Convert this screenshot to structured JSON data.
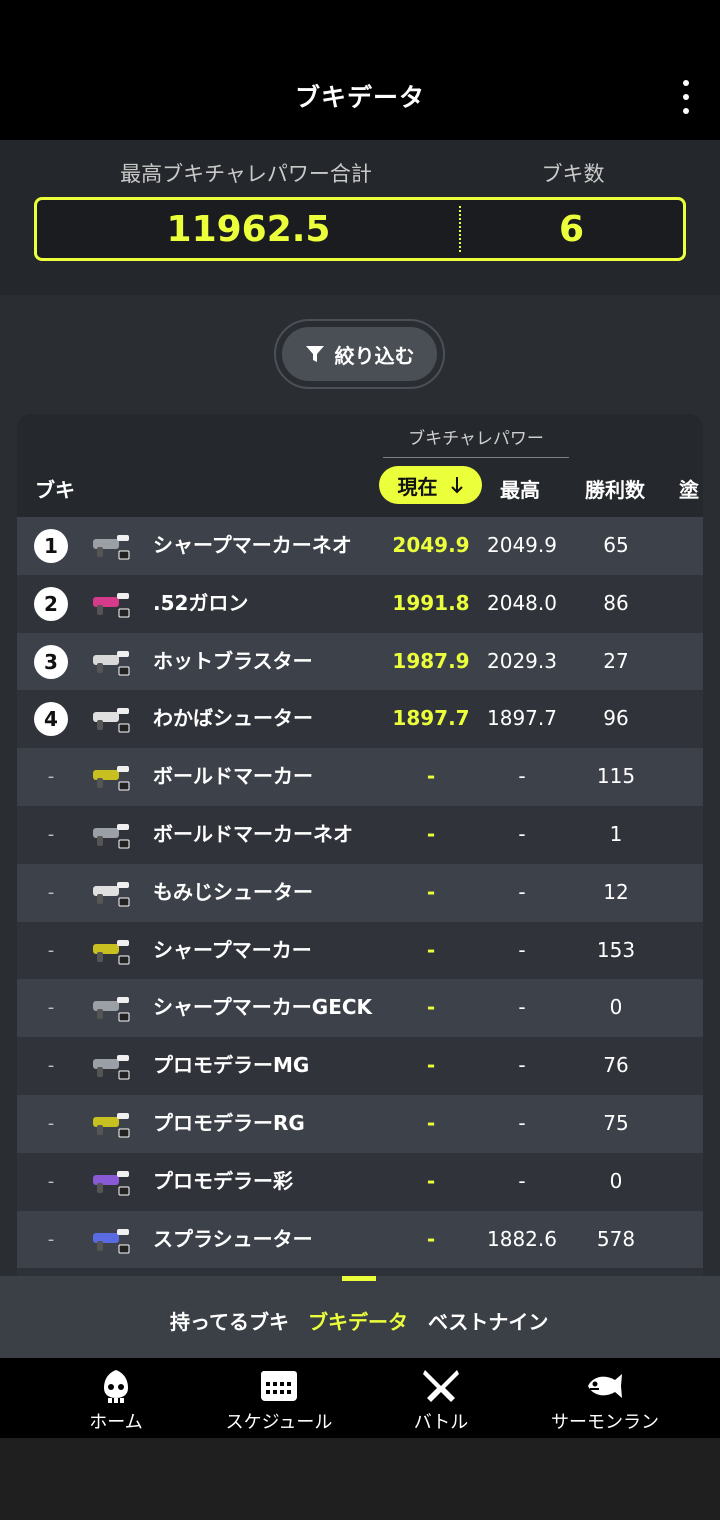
{
  "header": {
    "title": "ブキデータ"
  },
  "summary": {
    "total_label": "最高ブキチャレパワー合計",
    "count_label": "ブキ数",
    "total_value": "11962.5",
    "count_value": "6"
  },
  "filter": {
    "label": "絞り込む"
  },
  "table": {
    "group_label": "ブキチャレパワー",
    "col_weapon": "ブキ",
    "col_now": "現在",
    "col_max": "最高",
    "col_wins": "勝利数",
    "col_paint": "塗",
    "rows": [
      {
        "rank": "1",
        "name": "シャープマーカーネオ",
        "now": "2049.9",
        "max": "2049.9",
        "wins": "65"
      },
      {
        "rank": "2",
        "name": ".52ガロン",
        "now": "1991.8",
        "max": "2048.0",
        "wins": "86"
      },
      {
        "rank": "3",
        "name": "ホットブラスター",
        "now": "1987.9",
        "max": "2029.3",
        "wins": "27"
      },
      {
        "rank": "4",
        "name": "わかばシューター",
        "now": "1897.7",
        "max": "1897.7",
        "wins": "96"
      },
      {
        "rank": "-",
        "name": "ボールドマーカー",
        "now": "-",
        "max": "-",
        "wins": "115"
      },
      {
        "rank": "-",
        "name": "ボールドマーカーネオ",
        "now": "-",
        "max": "-",
        "wins": "1"
      },
      {
        "rank": "-",
        "name": "もみじシューター",
        "now": "-",
        "max": "-",
        "wins": "12"
      },
      {
        "rank": "-",
        "name": "シャープマーカー",
        "now": "-",
        "max": "-",
        "wins": "153"
      },
      {
        "rank": "-",
        "name": "シャープマーカーGECK",
        "now": "-",
        "max": "-",
        "wins": "0"
      },
      {
        "rank": "-",
        "name": "プロモデラーMG",
        "now": "-",
        "max": "-",
        "wins": "76"
      },
      {
        "rank": "-",
        "name": "プロモデラーRG",
        "now": "-",
        "max": "-",
        "wins": "75"
      },
      {
        "rank": "-",
        "name": "プロモデラー彩",
        "now": "-",
        "max": "-",
        "wins": "0"
      },
      {
        "rank": "-",
        "name": "スプラシューター",
        "now": "-",
        "max": "1882.6",
        "wins": "578"
      }
    ]
  },
  "subtabs": {
    "owned": "持ってるブキ",
    "data": "ブキデータ",
    "best9": "ベストナイン"
  },
  "nav": {
    "home": "ホーム",
    "schedule": "スケジュール",
    "battle": "バトル",
    "salmon": "サーモンラン"
  },
  "colors": {
    "accent": "#ebff3a",
    "background": "#2a2e33",
    "header": "#000000"
  },
  "icons": {
    "weapon": "weapon-icon",
    "filter": "filter-icon",
    "more": "more-vert-icon",
    "sort": "arrow-down-icon"
  }
}
